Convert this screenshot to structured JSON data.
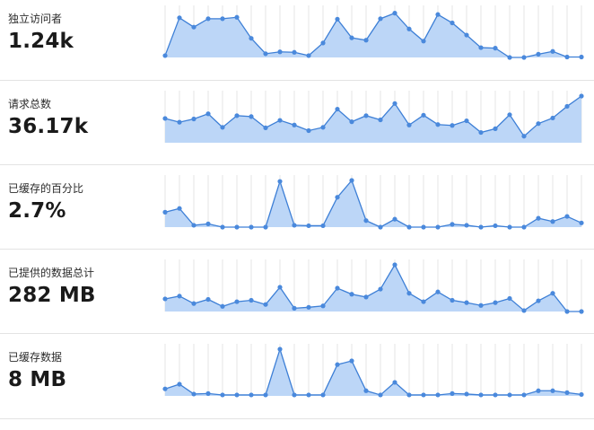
{
  "colors": {
    "area": "#bcd6f7",
    "line": "#3d7fd6",
    "point": "#4a89dc",
    "grid": "#e6e6e6",
    "divider": "#e3e3e3"
  },
  "metrics": [
    {
      "label": "独立访问者",
      "value": "1.24k",
      "chart_data": {
        "type": "area",
        "ylim": [
          0,
          1
        ],
        "values": [
          0.04,
          0.85,
          0.65,
          0.83,
          0.83,
          0.86,
          0.41,
          0.08,
          0.12,
          0.11,
          0.04,
          0.31,
          0.82,
          0.42,
          0.37,
          0.83,
          0.95,
          0.61,
          0.35,
          0.92,
          0.74,
          0.48,
          0.21,
          0.2,
          0.0,
          0.0,
          0.07,
          0.13,
          0.01,
          0.01
        ]
      }
    },
    {
      "label": "请求总数",
      "value": "36.17k",
      "chart_data": {
        "type": "area",
        "ylim": [
          0,
          1
        ],
        "values": [
          0.52,
          0.44,
          0.51,
          0.62,
          0.33,
          0.58,
          0.56,
          0.32,
          0.48,
          0.38,
          0.26,
          0.33,
          0.72,
          0.45,
          0.58,
          0.49,
          0.84,
          0.38,
          0.59,
          0.39,
          0.37,
          0.47,
          0.22,
          0.3,
          0.6,
          0.14,
          0.41,
          0.53,
          0.78,
          1.0
        ]
      }
    },
    {
      "label": "已缓存的百分比",
      "value": "2.7%",
      "chart_data": {
        "type": "area",
        "ylim": [
          0,
          1
        ],
        "values": [
          0.32,
          0.4,
          0.04,
          0.07,
          0.0,
          0.0,
          0.0,
          0.0,
          0.98,
          0.04,
          0.03,
          0.03,
          0.64,
          1.0,
          0.14,
          0.0,
          0.17,
          0.0,
          0.0,
          0.0,
          0.06,
          0.04,
          0.0,
          0.03,
          0.0,
          0.0,
          0.19,
          0.12,
          0.23,
          0.09
        ]
      }
    },
    {
      "label": "已提供的数据总计",
      "value": "282 MB",
      "chart_data": {
        "type": "area",
        "ylim": [
          0,
          1
        ],
        "values": [
          0.27,
          0.33,
          0.17,
          0.26,
          0.11,
          0.21,
          0.24,
          0.15,
          0.52,
          0.07,
          0.09,
          0.12,
          0.5,
          0.37,
          0.31,
          0.48,
          1.0,
          0.39,
          0.21,
          0.42,
          0.24,
          0.19,
          0.13,
          0.19,
          0.28,
          0.02,
          0.23,
          0.39,
          0.0,
          0.0
        ]
      }
    },
    {
      "label": "已缓存数据",
      "value": "8 MB",
      "chart_data": {
        "type": "area",
        "ylim": [
          0,
          1
        ],
        "values": [
          0.15,
          0.25,
          0.04,
          0.05,
          0.02,
          0.02,
          0.02,
          0.02,
          1.0,
          0.02,
          0.02,
          0.02,
          0.67,
          0.75,
          0.11,
          0.02,
          0.29,
          0.02,
          0.02,
          0.02,
          0.05,
          0.04,
          0.02,
          0.02,
          0.02,
          0.02,
          0.11,
          0.11,
          0.07,
          0.03
        ]
      }
    }
  ]
}
